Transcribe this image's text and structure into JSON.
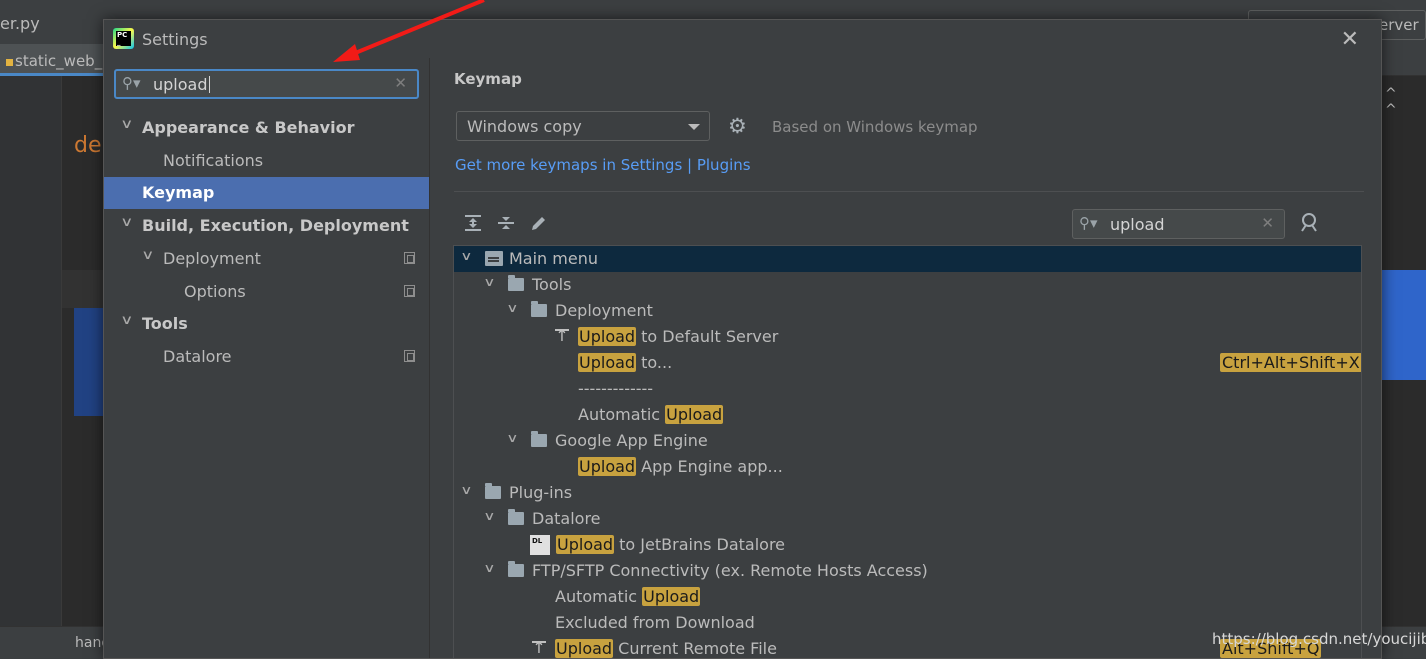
{
  "ide": {
    "file_name": "er.py",
    "tab_label": "static_web_se",
    "editor_text": "de",
    "server_label": "erver",
    "status_text": "hand"
  },
  "dialog": {
    "title": "Settings",
    "close_label": "✕"
  },
  "sidebar": {
    "search_value": "upload",
    "items": [
      {
        "label": "Appearance & Behavior",
        "level": 0,
        "expanded": true,
        "bold": true
      },
      {
        "label": "Notifications",
        "level": 1
      },
      {
        "label": "Keymap",
        "level": 0,
        "selected": true,
        "bold": true
      },
      {
        "label": "Build, Execution, Deployment",
        "level": 0,
        "expanded": true,
        "bold": true
      },
      {
        "label": "Deployment",
        "level": 1,
        "expanded": true,
        "has_copy": true
      },
      {
        "label": "Options",
        "level": 2,
        "has_copy": true
      },
      {
        "label": "Tools",
        "level": 0,
        "expanded": true,
        "bold": true
      },
      {
        "label": "Datalore",
        "level": 1,
        "has_copy": true
      }
    ]
  },
  "keymap": {
    "section_title": "Keymap",
    "selected_keymap": "Windows copy",
    "based_on": "Based on Windows keymap",
    "link_text": "Get more keymaps in Settings | Plugins",
    "search_value": "upload",
    "highlight_color": "#c8a23f",
    "accent_color": "#4b6eaf",
    "toolbar_icons": [
      "expand-all-icon",
      "collapse-all-icon",
      "edit-icon"
    ],
    "tree": [
      {
        "label": "Main menu",
        "level": 0,
        "icon": "menu",
        "expanded": true,
        "selected": true
      },
      {
        "label": "Tools",
        "level": 1,
        "icon": "folder",
        "expanded": true
      },
      {
        "label": "Deployment",
        "level": 2,
        "icon": "folder",
        "expanded": true
      },
      {
        "pre": "",
        "hl": "Upload",
        "post": " to Default Server",
        "level": 3,
        "icon": "upload"
      },
      {
        "pre": "",
        "hl": "Upload",
        "post": " to...",
        "level": 3,
        "icon": "none",
        "shortcut": "Ctrl+Alt+Shift+X"
      },
      {
        "label": "-------------",
        "level": 3,
        "icon": "none"
      },
      {
        "pre": "Automatic ",
        "hl": "Upload",
        "post": "",
        "level": 3,
        "icon": "none"
      },
      {
        "label": "Google App Engine",
        "level": 2,
        "icon": "folder",
        "expanded": true
      },
      {
        "pre": "",
        "hl": "Upload",
        "post": " App Engine app...",
        "level": 3,
        "icon": "none"
      },
      {
        "label": "Plug-ins",
        "level": 0,
        "icon": "folder",
        "expanded": true
      },
      {
        "label": "Datalore",
        "level": 1,
        "icon": "folder",
        "expanded": true
      },
      {
        "pre": "",
        "hl": "Upload",
        "post": " to JetBrains Datalore",
        "level": 2,
        "icon": "dl"
      },
      {
        "label": "FTP/SFTP Connectivity (ex. Remote Hosts Access)",
        "level": 1,
        "icon": "folder",
        "expanded": true
      },
      {
        "pre": "Automatic ",
        "hl": "Upload",
        "post": "",
        "level": 2,
        "icon": "none"
      },
      {
        "label": "Excluded from Download",
        "level": 2,
        "icon": "none"
      },
      {
        "pre": "",
        "hl": "Upload",
        "post": " Current Remote File",
        "level": 2,
        "icon": "upload",
        "shortcut": "Alt+Shift+Q"
      }
    ]
  },
  "watermark": "https://blog.csdn.net/youcijibi"
}
